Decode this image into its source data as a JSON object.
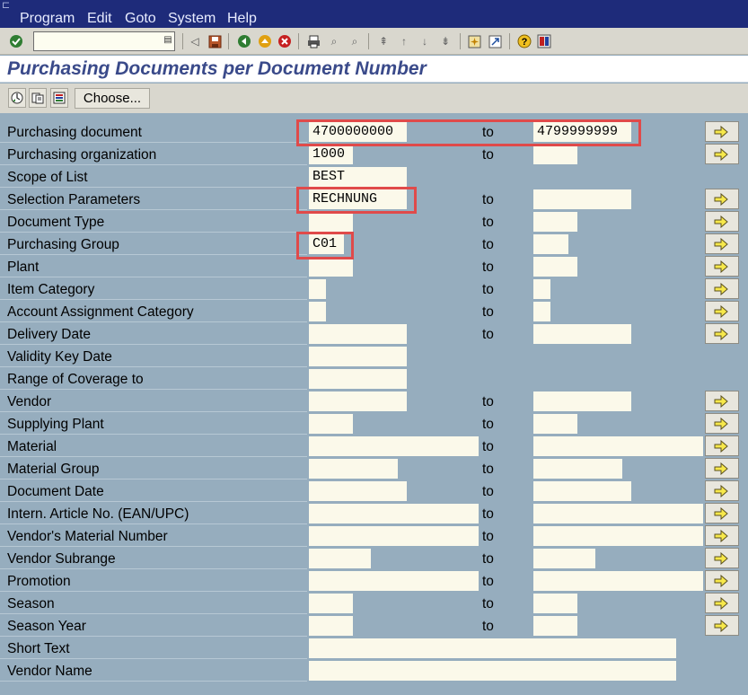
{
  "menu": [
    "Program",
    "Edit",
    "Goto",
    "System",
    "Help"
  ],
  "title": "Purchasing Documents per Document Number",
  "app_toolbar": {
    "choose_label": "Choose..."
  },
  "to_label": "to",
  "fields": [
    {
      "label": "Purchasing document",
      "low": "4700000000",
      "high": "4799999999"
    },
    {
      "label": "Purchasing organization",
      "low": "1000",
      "high": ""
    },
    {
      "label": "Scope of List",
      "low": "BEST"
    },
    {
      "label": "Selection Parameters",
      "low": "RECHNUNG",
      "high": ""
    },
    {
      "label": "Document Type",
      "low": "",
      "high": ""
    },
    {
      "label": "Purchasing Group",
      "low": "C01",
      "high": ""
    },
    {
      "label": "Plant",
      "low": "",
      "high": ""
    },
    {
      "label": "Item Category",
      "low": "",
      "high": ""
    },
    {
      "label": "Account Assignment Category",
      "low": "",
      "high": ""
    },
    {
      "label": "Delivery Date",
      "low": "",
      "high": ""
    },
    {
      "label": "Validity Key Date",
      "low": ""
    },
    {
      "label": "Range of Coverage to",
      "low": ""
    },
    {
      "label": "Vendor",
      "low": "",
      "high": ""
    },
    {
      "label": "Supplying Plant",
      "low": "",
      "high": ""
    },
    {
      "label": "Material",
      "low": "",
      "high": ""
    },
    {
      "label": "Material Group",
      "low": "",
      "high": ""
    },
    {
      "label": "Document Date",
      "low": "",
      "high": ""
    },
    {
      "label": "Intern. Article No. (EAN/UPC)",
      "low": "",
      "high": ""
    },
    {
      "label": "Vendor's Material Number",
      "low": "",
      "high": ""
    },
    {
      "label": "Vendor Subrange",
      "low": "",
      "high": ""
    },
    {
      "label": "Promotion",
      "low": "",
      "high": ""
    },
    {
      "label": "Season",
      "low": "",
      "high": ""
    },
    {
      "label": "Season Year",
      "low": "",
      "high": ""
    },
    {
      "label": "Short Text",
      "low": ""
    },
    {
      "label": "Vendor Name",
      "low": ""
    }
  ],
  "colors": {
    "highlight": "#e04a4a",
    "background": "#96adbe",
    "field": "#fbf9ea",
    "title": "#3a4a8a"
  }
}
